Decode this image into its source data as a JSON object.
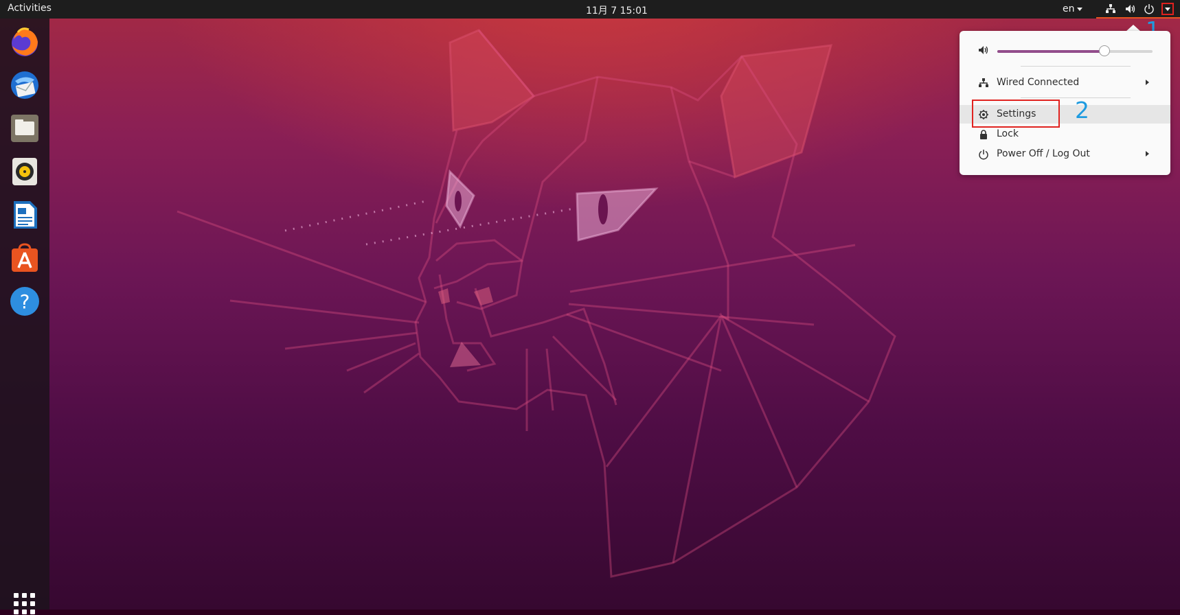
{
  "topbar": {
    "activities_label": "Activities",
    "clock": "11月 7  15:01",
    "language": "en"
  },
  "dock": {
    "items": [
      "firefox-icon",
      "thunderbird-icon",
      "files-icon",
      "rhythmbox-icon",
      "libreoffice-writer-icon",
      "ubuntu-software-icon",
      "help-icon",
      "show-applications-icon"
    ]
  },
  "system_menu": {
    "volume_level": 0.69,
    "network_label": "Wired Connected",
    "settings_label": "Settings",
    "lock_label": "Lock",
    "power_label": "Power Off / Log Out"
  },
  "annotations": {
    "step1": "1",
    "step2": "2"
  },
  "colors": {
    "accent": "#e95420",
    "slider_fill": "#924d8b",
    "highlight_box": "#e0221f",
    "annotation_text": "#1e9be0"
  }
}
